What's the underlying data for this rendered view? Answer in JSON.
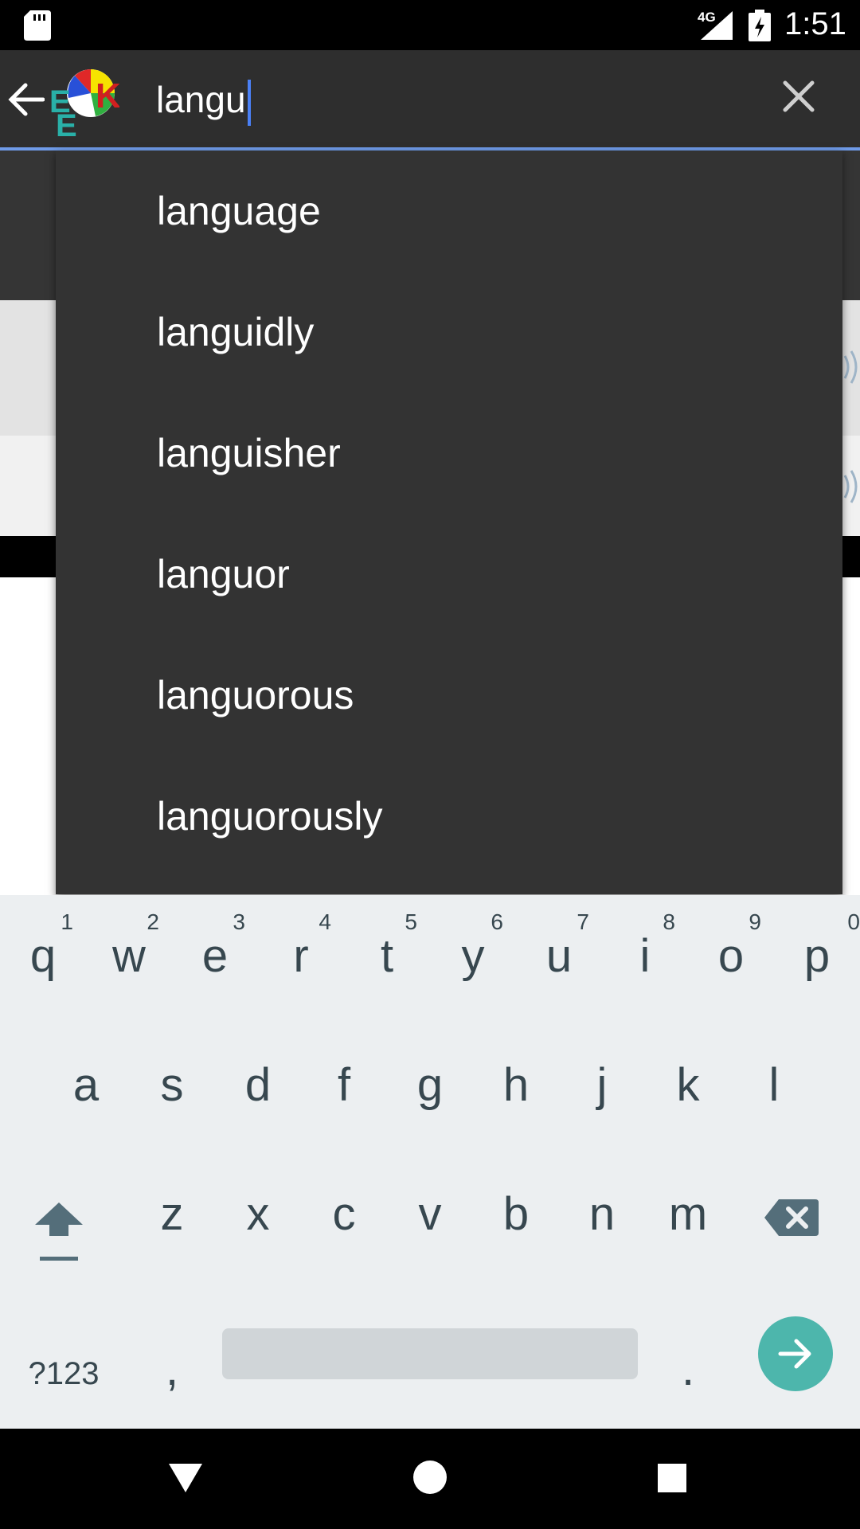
{
  "status_bar": {
    "network": "4G",
    "time": "1:51"
  },
  "search": {
    "query": "langu"
  },
  "suggestions": [
    "language",
    "languidly",
    "languisher",
    "languor",
    "languorous",
    "languorously"
  ],
  "keyboard": {
    "row1": [
      {
        "key": "q",
        "hint": "1"
      },
      {
        "key": "w",
        "hint": "2"
      },
      {
        "key": "e",
        "hint": "3"
      },
      {
        "key": "r",
        "hint": "4"
      },
      {
        "key": "t",
        "hint": "5"
      },
      {
        "key": "y",
        "hint": "6"
      },
      {
        "key": "u",
        "hint": "7"
      },
      {
        "key": "i",
        "hint": "8"
      },
      {
        "key": "o",
        "hint": "9"
      },
      {
        "key": "p",
        "hint": "0"
      }
    ],
    "row2": [
      "a",
      "s",
      "d",
      "f",
      "g",
      "h",
      "j",
      "k",
      "l"
    ],
    "row3": [
      "z",
      "x",
      "c",
      "v",
      "b",
      "n",
      "m"
    ],
    "symbols_label": "?123",
    "comma_label": ",",
    "period_label": "."
  },
  "colors": {
    "accent": "#4a80f5",
    "enter_key": "#4db6ac",
    "toolbar": "#2e2e2e",
    "dropdown": "#333333",
    "keyboard_bg": "#eceff1"
  }
}
